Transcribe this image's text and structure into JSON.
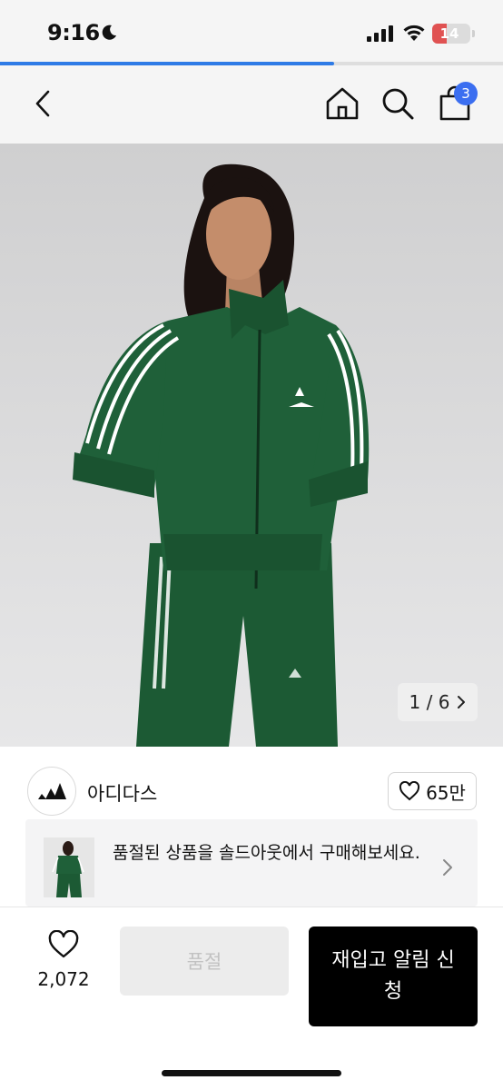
{
  "status_bar": {
    "time": "9:16",
    "battery_level": "14"
  },
  "page_progress": 0.665,
  "nav": {
    "cart_badge": "3"
  },
  "product_image": {
    "counter_current": "1",
    "counter_total": "6",
    "counter_text": "1 / 6"
  },
  "brand": {
    "name": "아디다스",
    "likes": "65만"
  },
  "soldout_banner": {
    "text": "품절된 상품을 솔드아웃에서 구매해보세요."
  },
  "bottom_bar": {
    "wish_count": "2,072",
    "soldout_label": "품절",
    "restock_label": "재입고 알림 신청"
  },
  "colors": {
    "accent_blue": "#2f7be6",
    "badge_blue": "#3b6ef0",
    "jacket_green": "#1d5b35",
    "battery_red": "#e05252"
  }
}
